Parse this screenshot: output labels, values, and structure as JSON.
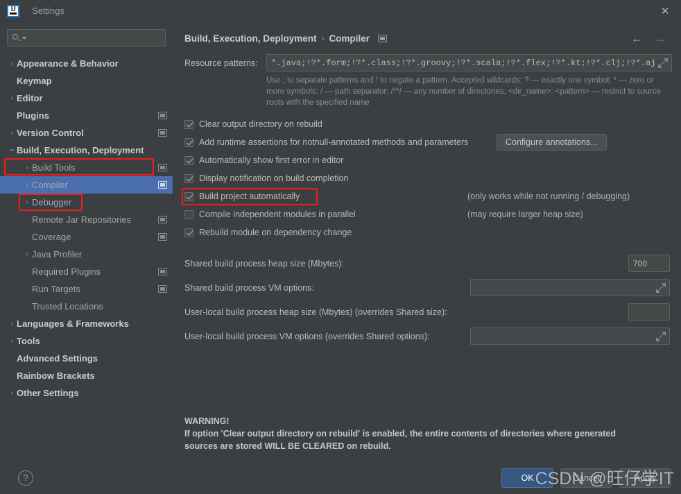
{
  "window": {
    "title": "Settings",
    "logo_alt": "IJ",
    "close_label": "✕"
  },
  "search": {
    "value": "",
    "placeholder": ""
  },
  "sidebar": {
    "items": [
      {
        "label": "Appearance & Behavior",
        "indent": 0,
        "arrow": "›",
        "bold": true,
        "project_icon": false,
        "selected": false
      },
      {
        "label": "Keymap",
        "indent": 0,
        "arrow": "",
        "bold": true,
        "project_icon": false,
        "selected": false
      },
      {
        "label": "Editor",
        "indent": 0,
        "arrow": "›",
        "bold": true,
        "project_icon": false,
        "selected": false
      },
      {
        "label": "Plugins",
        "indent": 0,
        "arrow": "",
        "bold": true,
        "project_icon": true,
        "selected": false
      },
      {
        "label": "Version Control",
        "indent": 0,
        "arrow": "›",
        "bold": true,
        "project_icon": true,
        "selected": false
      },
      {
        "label": "Build, Execution, Deployment",
        "indent": 0,
        "arrow": "⌄",
        "bold": true,
        "project_icon": false,
        "selected": false
      },
      {
        "label": "Build Tools",
        "indent": 1,
        "arrow": "›",
        "bold": false,
        "project_icon": true,
        "selected": false
      },
      {
        "label": "Compiler",
        "indent": 1,
        "arrow": "›",
        "bold": false,
        "project_icon": true,
        "selected": true
      },
      {
        "label": "Debugger",
        "indent": 1,
        "arrow": "›",
        "bold": false,
        "project_icon": false,
        "selected": false
      },
      {
        "label": "Remote Jar Repositories",
        "indent": 1,
        "arrow": "",
        "bold": false,
        "project_icon": true,
        "selected": false
      },
      {
        "label": "Coverage",
        "indent": 1,
        "arrow": "",
        "bold": false,
        "project_icon": true,
        "selected": false
      },
      {
        "label": "Java Profiler",
        "indent": 1,
        "arrow": "›",
        "bold": false,
        "project_icon": false,
        "selected": false
      },
      {
        "label": "Required Plugins",
        "indent": 1,
        "arrow": "",
        "bold": false,
        "project_icon": true,
        "selected": false
      },
      {
        "label": "Run Targets",
        "indent": 1,
        "arrow": "",
        "bold": false,
        "project_icon": true,
        "selected": false
      },
      {
        "label": "Trusted Locations",
        "indent": 1,
        "arrow": "",
        "bold": false,
        "project_icon": false,
        "selected": false
      },
      {
        "label": "Languages & Frameworks",
        "indent": 0,
        "arrow": "›",
        "bold": true,
        "project_icon": false,
        "selected": false
      },
      {
        "label": "Tools",
        "indent": 0,
        "arrow": "›",
        "bold": true,
        "project_icon": false,
        "selected": false
      },
      {
        "label": "Advanced Settings",
        "indent": 0,
        "arrow": "",
        "bold": true,
        "project_icon": false,
        "selected": false
      },
      {
        "label": "Rainbow Brackets",
        "indent": 0,
        "arrow": "",
        "bold": true,
        "project_icon": false,
        "selected": false
      },
      {
        "label": "Other Settings",
        "indent": 0,
        "arrow": "›",
        "bold": true,
        "project_icon": false,
        "selected": false
      }
    ]
  },
  "header": {
    "breadcrumb_root": "Build, Execution, Deployment",
    "breadcrumb_separator": "›",
    "breadcrumb_leaf": "Compiler",
    "back_arrow": "←",
    "forward_arrow": "→"
  },
  "resource_patterns": {
    "label": "Resource patterns:",
    "value": "*.java;!?*.form;!?*.class;!?*.groovy;!?*.scala;!?*.flex;!?*.kt;!?*.clj;!?*.aj",
    "hint": "Use ; to separate patterns and ! to negate a pattern. Accepted wildcards: ? — exactly one symbol; * — zero or more symbols; / — path separator; /**/ — any number of directories;  <dir_name>: <pattern> — restrict to source roots with the specified name"
  },
  "checkboxes": [
    {
      "label": "Clear output directory on rebuild",
      "checked": true,
      "side": "",
      "highlighted": false
    },
    {
      "label": "Add runtime assertions for notnull-annotated methods and parameters",
      "checked": true,
      "side": "",
      "highlighted": false,
      "button": "Configure annotations..."
    },
    {
      "label": "Automatically show first error in editor",
      "checked": true,
      "side": "",
      "highlighted": false
    },
    {
      "label": "Display notification on build completion",
      "checked": true,
      "side": "",
      "highlighted": false
    },
    {
      "label": "Build project automatically",
      "checked": true,
      "side": "(only works while not running / debugging)",
      "highlighted": true
    },
    {
      "label": "Compile independent modules in parallel",
      "checked": false,
      "side": "(may require larger heap size)",
      "highlighted": false
    },
    {
      "label": "Rebuild module on dependency change",
      "checked": true,
      "side": "",
      "highlighted": false
    }
  ],
  "heap_fields": [
    {
      "label": "Shared build process heap size (Mbytes):",
      "value": "700",
      "size": "small",
      "expandable": false
    },
    {
      "label": "Shared build process VM options:",
      "value": "",
      "size": "wide",
      "expandable": true
    },
    {
      "label": "User-local build process heap size (Mbytes) (overrides Shared size):",
      "value": "",
      "size": "small",
      "expandable": false
    },
    {
      "label": "User-local build process VM options (overrides Shared options):",
      "value": "",
      "size": "wide",
      "expandable": true
    }
  ],
  "warning": {
    "line1": "WARNING!",
    "line2": "If option 'Clear output directory on rebuild' is enabled, the entire contents of directories where generated",
    "line3": "sources are stored WILL BE CLEARED on rebuild."
  },
  "footer": {
    "help_label": "?",
    "ok_label": "OK",
    "cancel_label": "Cancel",
    "apply_label": "Apply"
  },
  "watermark": {
    "text": "CSDN @旺仔学IT"
  },
  "colors": {
    "background": "#3c3f41",
    "selection_blue": "#4b6eaf",
    "primary_button": "#365880",
    "annotation_red": "#f01b1b",
    "text": "#bbbbbb",
    "field_background": "#45494a"
  }
}
